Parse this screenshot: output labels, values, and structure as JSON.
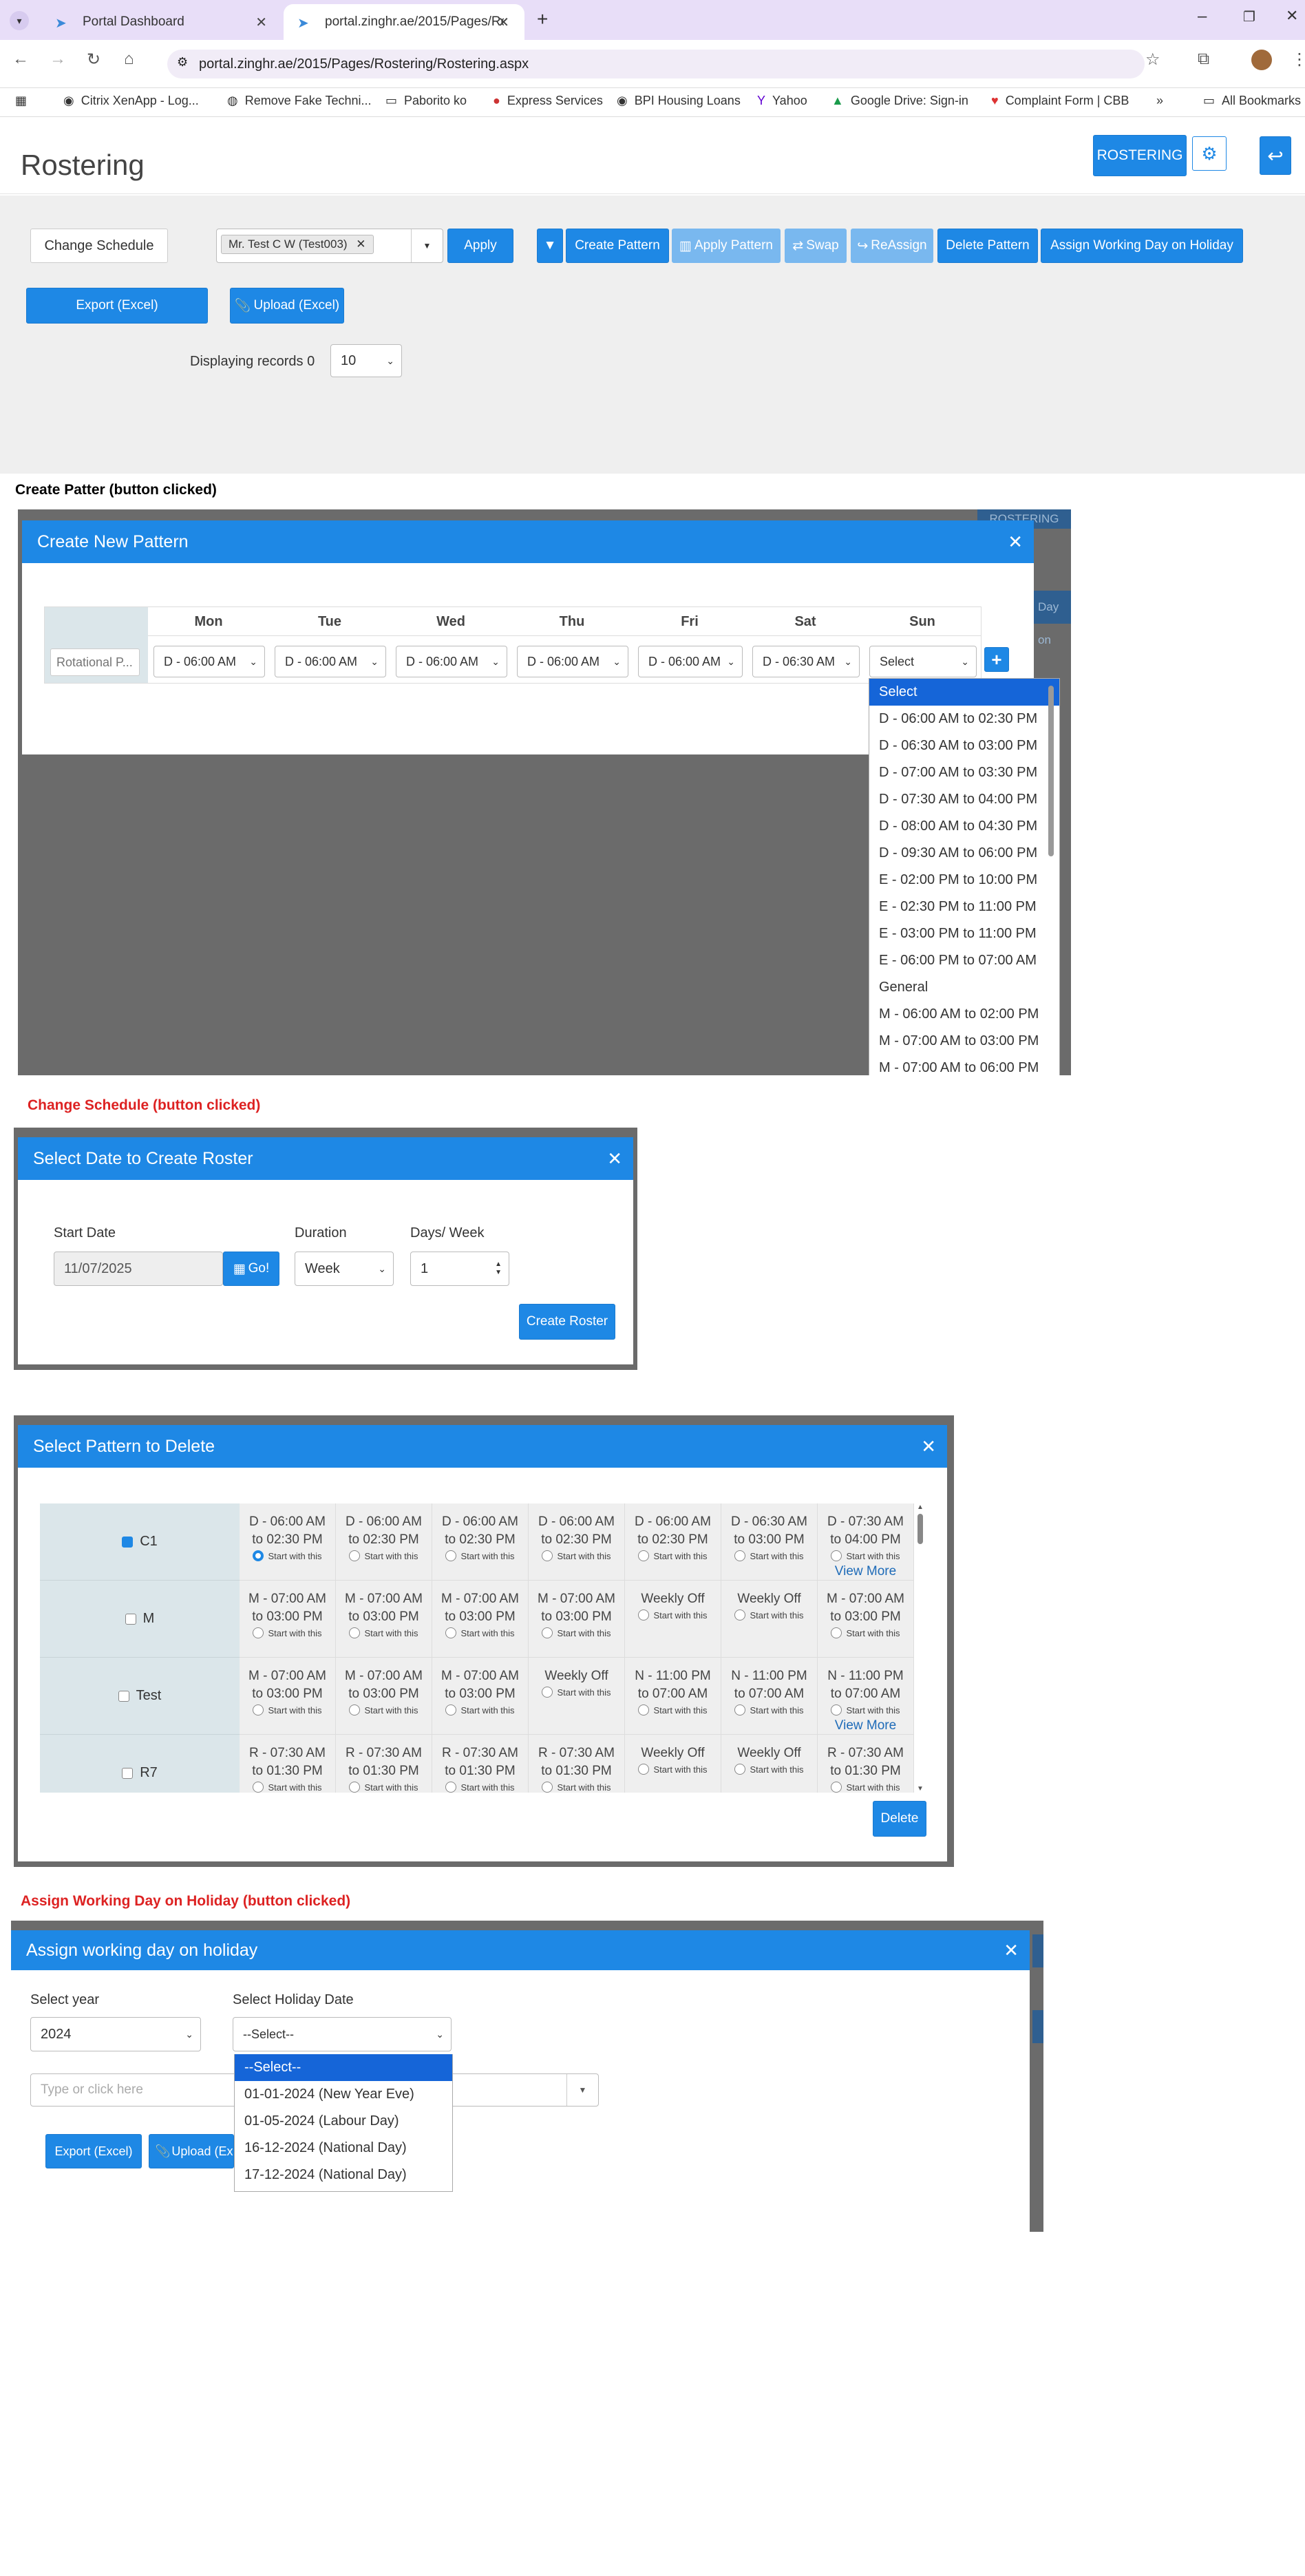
{
  "browser": {
    "tabs": [
      {
        "title": "Portal Dashboard"
      },
      {
        "title": "portal.zinghr.ae/2015/Pages/Ro"
      }
    ],
    "url": "portal.zinghr.ae/2015/Pages/Rostering/Rostering.aspx",
    "bookmarks": [
      "Citrix XenApp - Log...",
      "Remove Fake Techni...",
      "Paborito ko",
      "Express Services",
      "BPI Housing Loans",
      "Yahoo",
      "Google Drive: Sign-in",
      "Complaint Form | CBB"
    ],
    "more": "»",
    "all_bookmarks": "All Bookmarks"
  },
  "page": {
    "title": "Rostering",
    "header_btn": "ROSTERING",
    "change_schedule": "Change Schedule",
    "employee_tag": "Mr. Test C W (Test003)",
    "apply": "Apply",
    "create_pattern": "Create Pattern",
    "apply_pattern": "Apply Pattern",
    "swap": "Swap",
    "reassign": "ReAssign",
    "delete_pattern": "Delete Pattern",
    "assign_holiday": "Assign Working Day on Holiday",
    "export": "Export (Excel)",
    "upload": "Upload (Excel)",
    "displaying": "Displaying records 0",
    "page_size": "10"
  },
  "section1": {
    "caption": "Create Patter (button clicked)",
    "modal_title": "Create New Pattern",
    "bg_btn": "ROSTERING",
    "bg_text": "Day on",
    "name_placeholder": "Rotational P...",
    "days": [
      "Mon",
      "Tue",
      "Wed",
      "Thu",
      "Fri",
      "Sat",
      "Sun"
    ],
    "values": [
      "D - 06:00 AM",
      "D - 06:00 AM",
      "D - 06:00 AM",
      "D - 06:00 AM",
      "D - 06:00 AM",
      "D - 06:30 AM",
      "Select"
    ],
    "options": [
      "Select",
      "D - 06:00 AM to 02:30 PM",
      "D - 06:30 AM to 03:00 PM",
      "D - 07:00 AM to 03:30 PM",
      "D - 07:30 AM to 04:00 PM",
      "D - 08:00 AM to 04:30 PM",
      "D - 09:30 AM to 06:00 PM",
      "E - 02:00 PM to 10:00 PM",
      "E - 02:30 PM to 11:00 PM",
      "E - 03:00 PM to 11:00 PM",
      "E - 06:00 PM to 07:00 AM",
      "General",
      "M - 06:00 AM to 02:00 PM",
      "M - 07:00 AM to 03:00 PM",
      "M - 07:00 AM to 06:00 PM"
    ]
  },
  "section2": {
    "caption": "Change Schedule (button clicked)",
    "modal_title": "Select Date to Create Roster",
    "start_label": "Start Date",
    "start_value": "11/07/2025",
    "go": "Go!",
    "duration_label": "Duration",
    "duration_value": "Week",
    "days_label": "Days/ Week",
    "days_value": "1",
    "create_btn": "Create Roster"
  },
  "section3": {
    "modal_title": "Select Pattern to Delete",
    "start_with": "Start with this",
    "view_more": "View More",
    "rows": [
      {
        "name": "C1",
        "cells": [
          "D - 06:00 AM to 02:30 PM",
          "D - 06:00 AM to 02:30 PM",
          "D - 06:00 AM to 02:30 PM",
          "D - 06:00 AM to 02:30 PM",
          "D - 06:00 AM to 02:30 PM",
          "D - 06:30 AM to 03:00 PM",
          "D - 07:30 AM to 04:00 PM"
        ]
      },
      {
        "name": "M",
        "cells": [
          "M - 07:00 AM to 03:00 PM",
          "M - 07:00 AM to 03:00 PM",
          "M - 07:00 AM to 03:00 PM",
          "M - 07:00 AM to 03:00 PM",
          "Weekly Off",
          "Weekly Off",
          "M - 07:00 AM to 03:00 PM"
        ]
      },
      {
        "name": "Test",
        "cells": [
          "M - 07:00 AM to 03:00 PM",
          "M - 07:00 AM to 03:00 PM",
          "M - 07:00 AM to 03:00 PM",
          "Weekly Off",
          "N - 11:00 PM to 07:00 AM",
          "N - 11:00 PM to 07:00 AM",
          "N - 11:00 PM to 07:00 AM"
        ]
      },
      {
        "name": "R7",
        "cells": [
          "R - 07:30 AM to 01:30 PM",
          "R - 07:30 AM to 01:30 PM",
          "R - 07:30 AM to 01:30 PM",
          "R - 07:30 AM to 01:30 PM",
          "Weekly Off",
          "Weekly Off",
          "R - 07:30 AM to 01:30 PM"
        ]
      }
    ],
    "delete_btn": "Delete"
  },
  "section4": {
    "caption": "Assign Working Day on Holiday (button clicked)",
    "modal_title": "Assign working day on holiday",
    "year_label": "Select year",
    "year_value": "2024",
    "holiday_label": "Select Holiday Date",
    "holiday_value": "--Select--",
    "search_placeholder": "Type or click here",
    "options": [
      "--Select--",
      "01-01-2024 (New Year Eve)",
      "01-05-2024 (Labour Day)",
      "16-12-2024 (National Day)",
      "17-12-2024 (National Day)"
    ],
    "export": "Export (Excel)",
    "upload": "Upload (Ex"
  }
}
